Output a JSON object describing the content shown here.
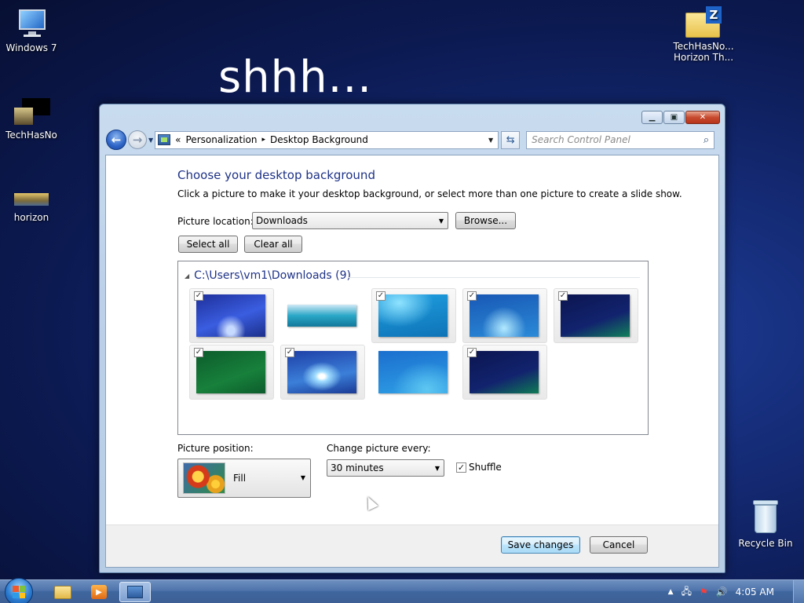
{
  "desktop": {
    "overlay_text": "shhh...",
    "icons": [
      {
        "label": "Windows 7"
      },
      {
        "label": "TechHasNo"
      },
      {
        "label": "horizon"
      },
      {
        "label": "TechHasNo...\nHorizon Th..."
      },
      {
        "label": "Recycle Bin"
      }
    ]
  },
  "window": {
    "breadcrumb": {
      "prefix": "«",
      "items": [
        "Personalization",
        "Desktop Background"
      ],
      "separator": "▸"
    },
    "search_placeholder": "Search Control Panel",
    "heading": "Choose your desktop background",
    "description": "Click a picture to make it your desktop background, or select more than one picture to create a slide show.",
    "picture_location_label": "Picture location:",
    "picture_location_value": "Downloads",
    "browse_label": "Browse...",
    "select_all_label": "Select all",
    "clear_all_label": "Clear all",
    "group_title": "C:\\Users\\vm1\\Downloads (9)",
    "thumbnails": [
      {
        "checked": true,
        "style": "blue-swirl"
      },
      {
        "checked": false,
        "style": "horizon"
      },
      {
        "checked": true,
        "style": "bird-blue"
      },
      {
        "checked": true,
        "style": "blue-light"
      },
      {
        "checked": true,
        "style": "dark-text"
      },
      {
        "checked": true,
        "style": "green"
      },
      {
        "checked": true,
        "style": "bright-swirl"
      },
      {
        "checked": false,
        "style": "blue-wave"
      },
      {
        "checked": true,
        "style": "dark-text2"
      }
    ],
    "picture_position_label": "Picture position:",
    "picture_position_value": "Fill",
    "change_every_label": "Change picture every:",
    "change_every_value": "30 minutes",
    "shuffle_label": "Shuffle",
    "shuffle_checked": true,
    "save_label": "Save changes",
    "cancel_label": "Cancel"
  },
  "taskbar": {
    "clock": "4:05 AM"
  }
}
